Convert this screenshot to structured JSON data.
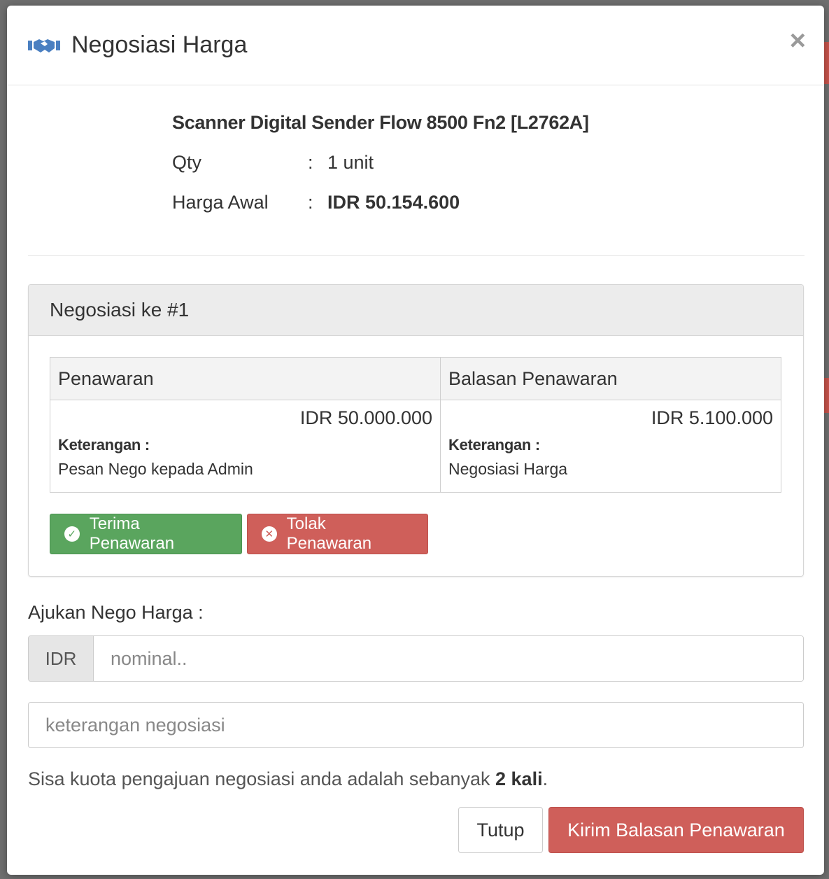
{
  "modal": {
    "title": "Negosiasi Harga",
    "close_symbol": "×",
    "header_icon": "handshake-icon"
  },
  "product": {
    "name": "Scanner Digital Sender Flow 8500 Fn2 [L2762A]",
    "qty_label": "Qty",
    "qty_value": "1 unit",
    "price_label": "Harga Awal",
    "price_value": "IDR 50.154.600",
    "colon": ":"
  },
  "negotiation": {
    "heading": "Negosiasi ke #1",
    "columns": [
      "Penawaran",
      "Balasan Penawaran"
    ],
    "offer": {
      "amount": "IDR 50.000.000",
      "note_label": "Keterangan :",
      "note": "Pesan Nego kepada Admin"
    },
    "reply": {
      "amount": "IDR 5.100.000",
      "note_label": "Keterangan :",
      "note": "Negosiasi Harga"
    },
    "accept_label": "Terima Penawaran",
    "reject_label": "Tolak Penawaran"
  },
  "form": {
    "nego_label": "Ajukan Nego Harga :",
    "currency_addon": "IDR",
    "nominal_placeholder": "nominal..",
    "note_placeholder": "keterangan negosiasi",
    "quota_prefix": "Sisa kuota pengajuan negosiasi anda adalah sebanyak ",
    "quota_value": "2 kali",
    "quota_suffix": "."
  },
  "footer": {
    "close_label": "Tutup",
    "submit_label": "Kirim Balasan Penawaran"
  },
  "colors": {
    "success": "#5aa55e",
    "danger": "#cf5f5a",
    "icon_blue": "#4a7fc1"
  }
}
